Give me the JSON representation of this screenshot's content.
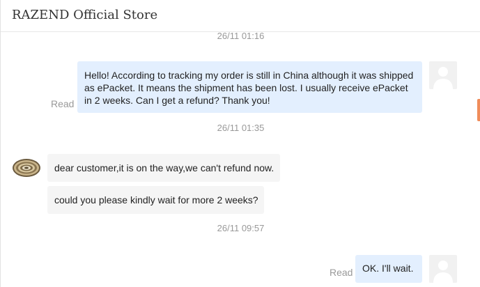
{
  "store": {
    "title": "RAZEND Official Store"
  },
  "conversation": {
    "timestamps": [
      "26/11 01:16",
      "26/11 01:35",
      "26/11 09:57"
    ],
    "messages": [
      {
        "direction": "outgoing",
        "text": "Hello! According to tracking my order is still in China although it was shipped as ePacket. It means the shipment has been lost. I usually receive ePacket in 2 weeks. Can I get a refund? Thank you!",
        "status": "Read"
      },
      {
        "direction": "incoming",
        "text": "dear customer,it is on the way,we can't refund now."
      },
      {
        "direction": "incoming",
        "text": "could you please kindly wait for more 2 weeks?"
      },
      {
        "direction": "outgoing",
        "text": "OK. I'll wait.",
        "status": "Read"
      }
    ]
  },
  "icons": {
    "user_avatar": "user-avatar-icon",
    "store_avatar": "led-strip-reel-icon"
  },
  "colors": {
    "outgoing_bubble": "#e3effe",
    "incoming_bubble": "#f5f5f5",
    "muted_text": "#999999",
    "scroll_indicator": "#f08c5a"
  }
}
